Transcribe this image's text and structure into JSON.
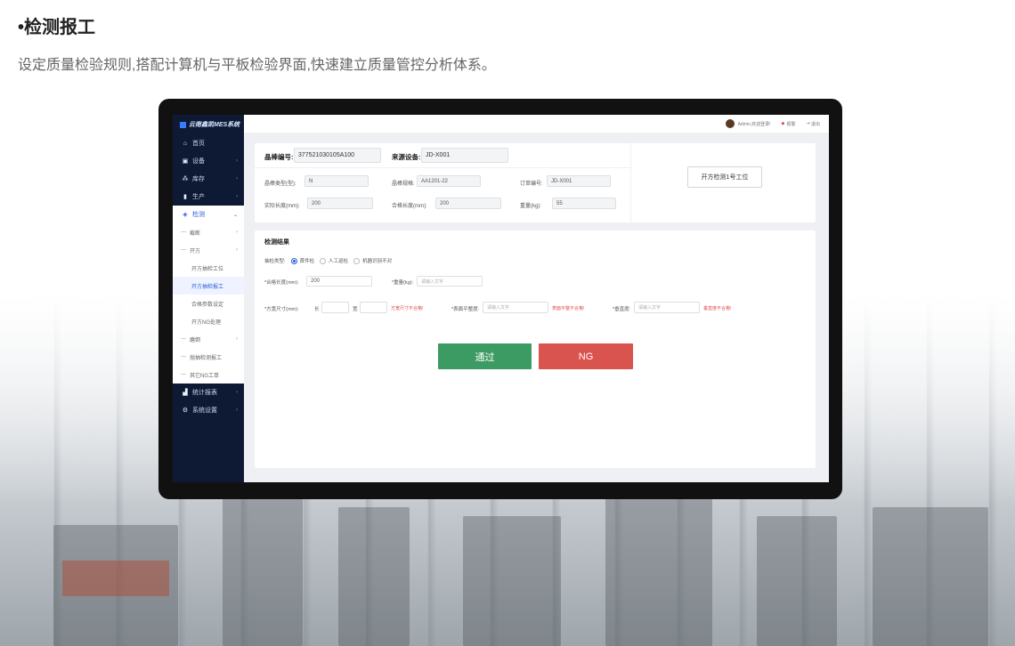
{
  "page": {
    "heading": "•检测报工",
    "subheading": "设定质量检验规则,搭配计算机与平板检验界面,快速建立质量管控分析体系。"
  },
  "app": {
    "logo_text": "云南鑫凯MES系统",
    "topbar": {
      "user_greeting": "Admin,欢迎登录!",
      "alerts_label": "报警",
      "logout_label": "退出"
    },
    "sidebar": {
      "items": [
        {
          "icon": "home-icon",
          "label": "首页"
        },
        {
          "icon": "device-icon",
          "label": "设备"
        },
        {
          "icon": "inventory-icon",
          "label": "库存"
        },
        {
          "icon": "production-icon",
          "label": "生产"
        },
        {
          "icon": "inspection-icon",
          "label": "检测"
        }
      ],
      "sub_items": [
        {
          "label": "截断"
        },
        {
          "label": "开方"
        }
      ],
      "leaf_items": [
        {
          "label": "开方抽检工位"
        },
        {
          "label": "开方抽检报工"
        },
        {
          "label": "合格参数设定"
        },
        {
          "label": "开方NG处理"
        }
      ],
      "sub_items_2": [
        {
          "label": "磨倒"
        },
        {
          "label": "抛抽检测报工"
        },
        {
          "label": "其它NG工单"
        }
      ],
      "bottom_items": [
        {
          "icon": "stats-icon",
          "label": "统计报表"
        },
        {
          "icon": "settings-icon",
          "label": "系统设置"
        }
      ]
    },
    "info_card": {
      "ingot_no_label": "晶棒编号:",
      "ingot_no_value": "377521030105A100",
      "source_device_label": "来源设备:",
      "source_device_value": "JD-X001",
      "ingot_type_label": "晶棒类型(型):",
      "ingot_type_value": "N",
      "ingot_spec_label": "晶棒规格:",
      "ingot_spec_value": "AA1201-22",
      "order_no_label": "订单编号:",
      "order_no_value": "JD-X001",
      "actual_length_label": "实际长度(mm):",
      "actual_length_value": "200",
      "qualified_length_label": "合格长度(mm):",
      "qualified_length_value": "200",
      "weight_label": "重量(kg):",
      "weight_value": "55",
      "station_button": "开方检测1号工位"
    },
    "result_card": {
      "title": "检测结果",
      "sampling_type_label": "抽检类型:",
      "options": [
        "首件检",
        "人工巡检",
        "机器识别不对"
      ],
      "qualified_length_label": "*合格长度(mm):",
      "qualified_length_value": "200",
      "weight_label": "*重量(kg):",
      "weight_placeholder": "请输入文字",
      "size_label": "*方宽尺寸(mm):",
      "length_label": "长",
      "width_label": "宽",
      "size_error": "方宽尺寸不合格!",
      "flatness_label": "*表面平整度:",
      "flatness_placeholder": "请输入文字",
      "flatness_error": "表面平整不合格!",
      "verticality_label": "*垂直度:",
      "verticality_placeholder": "请输入文字",
      "verticality_error": "垂直度不合格!",
      "pass_button": "通过",
      "ng_button": "NG"
    }
  },
  "colors": {
    "sidebar_bg": "#0e1a33",
    "accent": "#2a5bd7",
    "pass": "#3c9b62",
    "ng": "#d9534f",
    "error": "#e04b4b"
  }
}
